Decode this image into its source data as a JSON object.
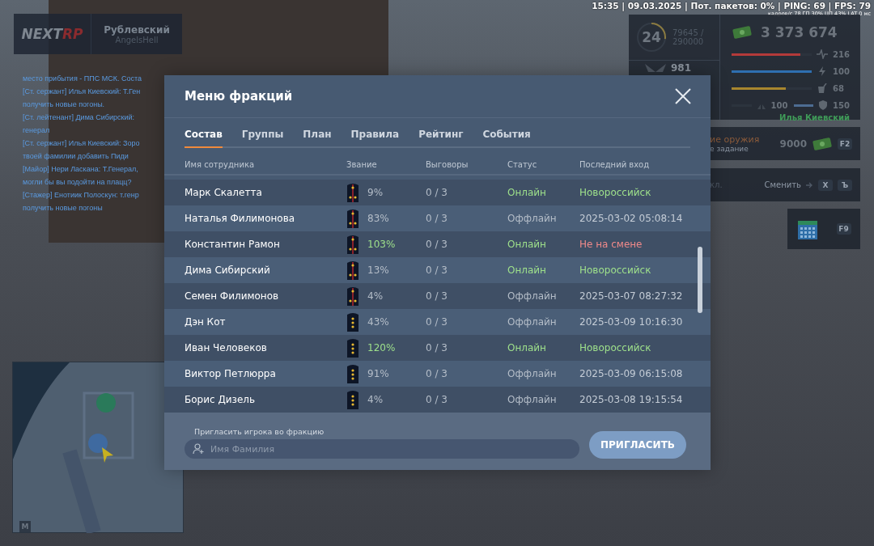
{
  "status_line": "15:35 | 09.03.2025 | Пот. пакетов: 0% | PING: 69 | FPS: 79",
  "perf_line": "кадров/с  78   ГП  30%  ЦП  43%  LAT  0 мс",
  "server_badge": {
    "logo_first": "NEXT",
    "logo_second": "RP",
    "server": "Рублевский",
    "nickname": "AngelsHell"
  },
  "chat": [
    "место прибытия - ППС МСК. Соста",
    "[Ст. сержант] Илья Киевский: Т.Ген",
    "получить новые погоны.",
    "[Ст. лейтенант] Дима Сибирский: ",
    "генерал",
    "[Ст. сержант] Илья Киевский: Зоро",
    "твоей фамилии добавить Пиди",
    "[Майор] Нери Ласкана: Т.Генерал,",
    "могли бы вы подойти на плацц?",
    "[Стажер] Енотиик Полоскун: т.генр",
    "получить новые погоны"
  ],
  "player_stats": {
    "level": "24",
    "xp": "79645 /",
    "xp_max": "290000",
    "xp_ring": {
      "level": 0.27
    },
    "reputation": "981",
    "money": "3 373 674",
    "bars": [
      {
        "kind": "health",
        "level": 0.86,
        "value": "216"
      },
      {
        "kind": "energy",
        "level": 1.0,
        "value": "100"
      },
      {
        "kind": "hunger",
        "level": 0.68,
        "value": "68"
      }
    ],
    "lungs": {
      "value": "100"
    },
    "armor": {
      "level": 1.0,
      "value": "150"
    },
    "player_name": "Илья Киевский"
  },
  "task_card": {
    "title": "ие оружия",
    "subtitle": "е задание",
    "reward": "9000",
    "key": "F2"
  },
  "mode_card": {
    "text": "кл.",
    "action": "Сменить",
    "keys": [
      "X",
      "Ъ"
    ]
  },
  "calendar_card": {
    "key": "F9"
  },
  "minimap": {
    "key": "M"
  },
  "modal": {
    "title": "Меню фракций",
    "tabs": [
      {
        "label": "Состав",
        "selected": true
      },
      {
        "label": "Группы",
        "selected": false
      },
      {
        "label": "План",
        "selected": false
      },
      {
        "label": "Правила",
        "selected": false
      },
      {
        "label": "Рейтинг",
        "selected": false
      },
      {
        "label": "События",
        "selected": false
      }
    ],
    "columns": [
      "Имя сотрудника",
      "Звание",
      "Выговоры",
      "Статус",
      "Последний вход"
    ],
    "rows": [
      {
        "name": "Марк Скалетта",
        "rank_stripe": true,
        "percent": "9%",
        "exceeded": false,
        "reprimands": "0 / 3",
        "status": "Онлайн",
        "online": true,
        "last_seen": "Новороссийск",
        "color": "#9ee08b"
      },
      {
        "name": "Наталья Филимонова",
        "rank_stripe": true,
        "percent": "83%",
        "exceeded": false,
        "reprimands": "0 / 3",
        "status": "Оффлайн",
        "online": false,
        "last_seen": "2025-03-02 05:08:14",
        "color": "#c4ccd6"
      },
      {
        "name": "Константин Рамон",
        "rank_stripe": true,
        "percent": "103%",
        "exceeded": true,
        "reprimands": "0 / 3",
        "status": "Онлайн",
        "online": true,
        "last_seen": "Не на смене",
        "color": "#f08a8a"
      },
      {
        "name": "Дима Сибирский",
        "rank_stripe": true,
        "percent": "13%",
        "exceeded": false,
        "reprimands": "0 / 3",
        "status": "Онлайн",
        "online": true,
        "last_seen": "Новороссийск",
        "color": "#9ee08b"
      },
      {
        "name": "Семен Филимонов",
        "rank_stripe": true,
        "percent": "4%",
        "exceeded": false,
        "reprimands": "0 / 3",
        "status": "Оффлайн",
        "online": false,
        "last_seen": "2025-03-07 08:27:32",
        "color": "#c4ccd6"
      },
      {
        "name": "Дэн Кот",
        "rank_stripe": false,
        "percent": "43%",
        "exceeded": false,
        "reprimands": "0 / 3",
        "status": "Оффлайн",
        "online": false,
        "last_seen": "2025-03-09 10:16:30",
        "color": "#c4ccd6"
      },
      {
        "name": "Иван Человеков",
        "rank_stripe": false,
        "percent": "120%",
        "exceeded": true,
        "reprimands": "0 / 3",
        "status": "Онлайн",
        "online": true,
        "last_seen": "Новороссийск",
        "color": "#9ee08b"
      },
      {
        "name": "Виктор Петлюрра",
        "rank_stripe": false,
        "percent": "91%",
        "exceeded": false,
        "reprimands": "0 / 3",
        "status": "Оффлайн",
        "online": false,
        "last_seen": "2025-03-09 06:15:08",
        "color": "#c4ccd6"
      },
      {
        "name": "Борис Дизель",
        "rank_stripe": false,
        "percent": "4%",
        "exceeded": false,
        "reprimands": "0 / 3",
        "status": "Оффлайн",
        "online": false,
        "last_seen": "2025-03-08 19:15:54",
        "color": "#c4ccd6"
      }
    ],
    "invite": {
      "label": "Пригласить игрока во фракцию",
      "placeholder": "Имя Фамилия",
      "button": "ПРИГЛАСИТЬ"
    }
  }
}
